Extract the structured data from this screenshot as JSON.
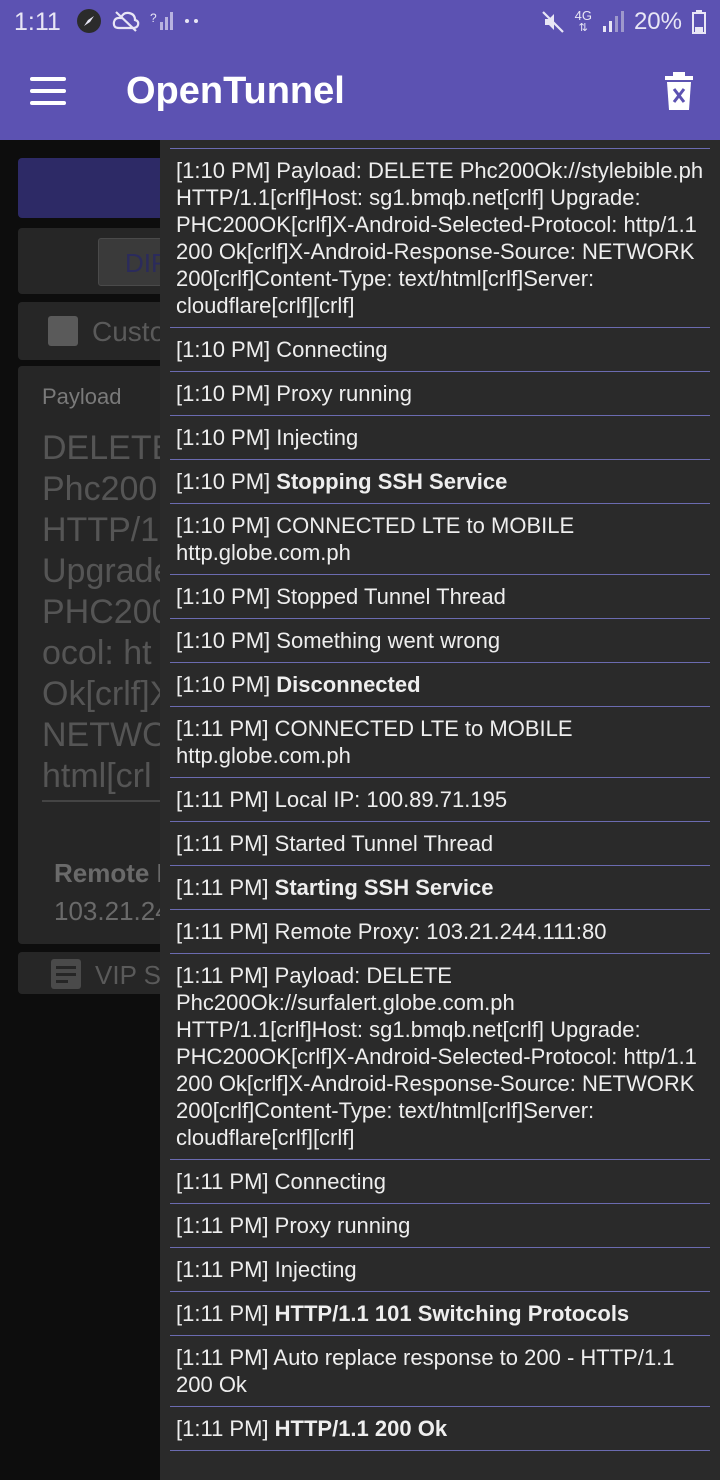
{
  "status_bar": {
    "time": "1:11",
    "battery": "20%",
    "network": "4G",
    "icons": [
      "compass-icon",
      "cloud-off-icon",
      "signal-question-icon",
      "dots-icon",
      "mute-icon",
      "signal-icon",
      "battery-icon"
    ]
  },
  "app_bar": {
    "title": "OpenTunnel",
    "menu_icon": "hamburger-icon",
    "action_icon": "delete-icon"
  },
  "background": {
    "mode_button": "DIR",
    "checkbox_label": "Custo",
    "payload_label": "Payload",
    "payload_lines": [
      "DELETE",
      "Phc200",
      "HTTP/1",
      "Upgrade",
      "PHC200",
      "ocol: ht",
      "Ok[crlf]X",
      "NETWO",
      "html[crl"
    ],
    "remote_label": "Remote P",
    "remote_value": "103.21.24",
    "vip_label": "VIP S"
  },
  "logs": [
    {
      "time": "[1:10 PM]",
      "text": "Payload: DELETE Phc200Ok://stylebible.ph HTTP/1.1[crlf]Host: sg1.bmqb.net[crlf] Upgrade: PHC200OK[crlf]X-Android-Selected-Protocol: http/1.1 200 Ok[crlf]X-Android-Response-Source: NETWORK 200[crlf]Content-Type: text/html[crlf]Server: cloudflare[crlf][crlf]",
      "bold": false
    },
    {
      "time": "[1:10 PM]",
      "text": "Connecting",
      "bold": false
    },
    {
      "time": "[1:10 PM]",
      "text": "Proxy running",
      "bold": false
    },
    {
      "time": "[1:10 PM]",
      "text": "Injecting",
      "bold": false
    },
    {
      "time": "[1:10 PM]",
      "text": "Stopping SSH Service",
      "bold": true
    },
    {
      "time": "[1:10 PM]",
      "text": "CONNECTED LTE to MOBILE http.globe.com.ph",
      "bold": false
    },
    {
      "time": "[1:10 PM]",
      "text": "Stopped Tunnel Thread",
      "bold": false
    },
    {
      "time": "[1:10 PM]",
      "text": "Something went wrong",
      "bold": false
    },
    {
      "time": "[1:10 PM]",
      "text": "Disconnected",
      "bold": true
    },
    {
      "time": "[1:11 PM]",
      "text": "CONNECTED LTE to MOBILE http.globe.com.ph",
      "bold": false
    },
    {
      "time": "[1:11 PM]",
      "text": "Local IP: 100.89.71.195",
      "bold": false
    },
    {
      "time": "[1:11 PM]",
      "text": "Started Tunnel Thread",
      "bold": false
    },
    {
      "time": "[1:11 PM]",
      "text": "Starting SSH Service",
      "bold": true
    },
    {
      "time": "[1:11 PM]",
      "text": "Remote Proxy: 103.21.244.111:80",
      "bold": false
    },
    {
      "time": "[1:11 PM]",
      "text": "Payload: DELETE Phc200Ok://surfalert.globe.com.ph HTTP/1.1[crlf]Host: sg1.bmqb.net[crlf] Upgrade: PHC200OK[crlf]X-Android-Selected-Protocol: http/1.1 200 Ok[crlf]X-Android-Response-Source: NETWORK 200[crlf]Content-Type: text/html[crlf]Server: cloudflare[crlf][crlf]",
      "bold": false
    },
    {
      "time": "[1:11 PM]",
      "text": "Connecting",
      "bold": false
    },
    {
      "time": "[1:11 PM]",
      "text": "Proxy running",
      "bold": false
    },
    {
      "time": "[1:11 PM]",
      "text": "Injecting",
      "bold": false
    },
    {
      "time": "[1:11 PM]",
      "text": "HTTP/1.1 101 Switching Protocols",
      "bold": true
    },
    {
      "time": "[1:11 PM]",
      "text": "Auto replace response to 200 - HTTP/1.1 200 Ok",
      "bold": false
    },
    {
      "time": "[1:11 PM]",
      "text": "HTTP/1.1 200 Ok",
      "bold": true
    }
  ]
}
